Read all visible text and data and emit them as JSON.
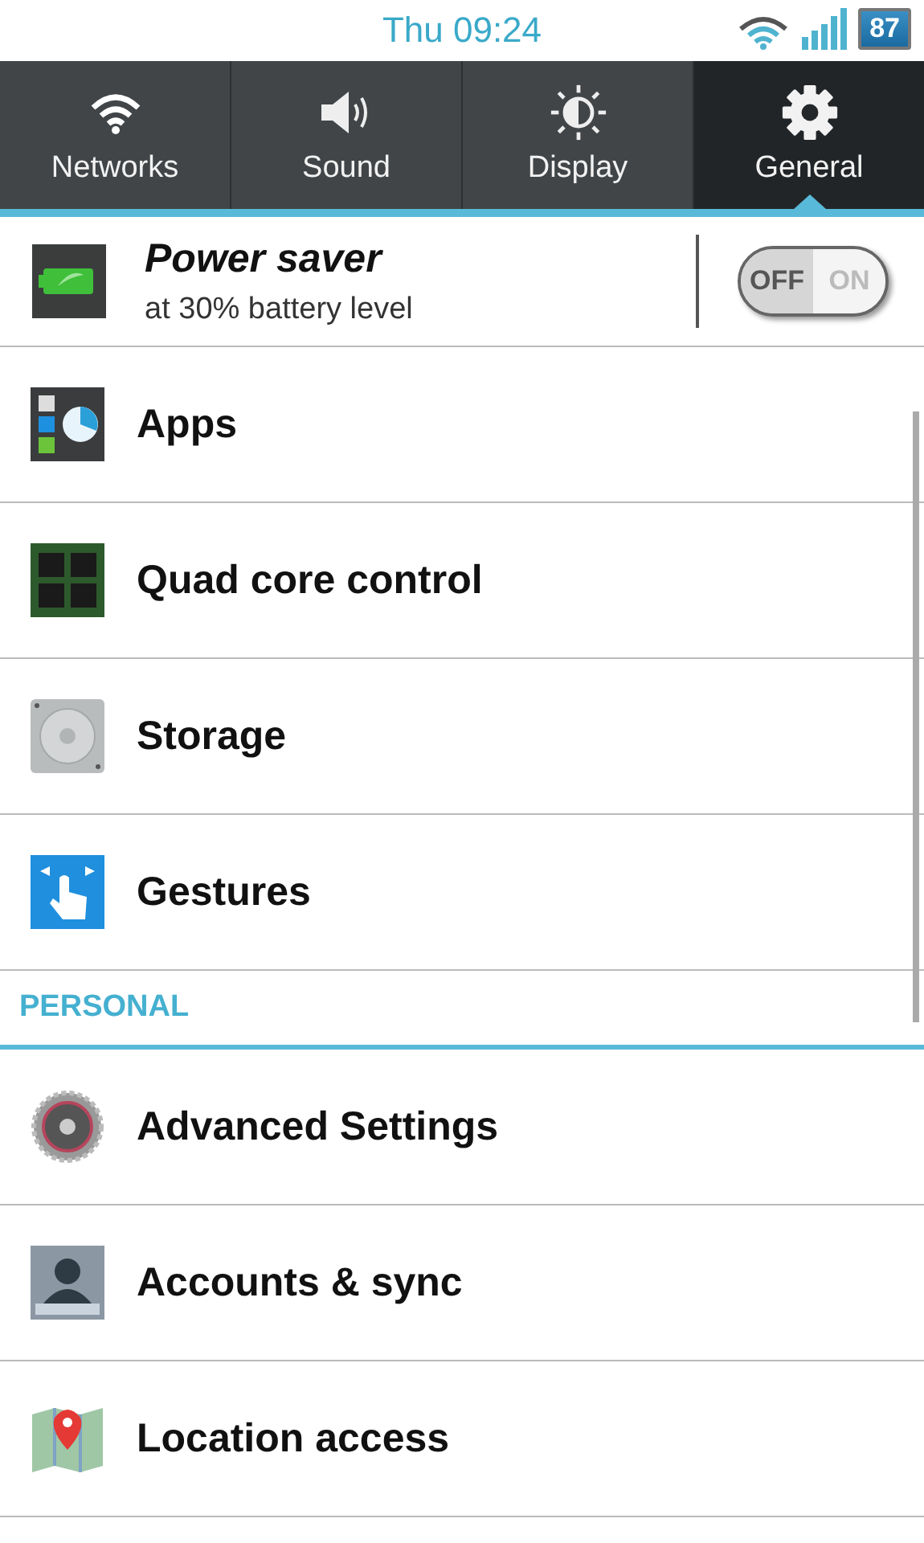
{
  "status_bar": {
    "time": "Thu 09:24",
    "battery": "87"
  },
  "tabs": [
    {
      "label": "Networks",
      "kind": "wifi",
      "selected": false
    },
    {
      "label": "Sound",
      "kind": "speaker",
      "selected": false
    },
    {
      "label": "Display",
      "kind": "brightness",
      "selected": false
    },
    {
      "label": "General",
      "kind": "gear",
      "selected": true
    }
  ],
  "power_saver": {
    "title": "Power saver",
    "subtitle": "at 30% battery level",
    "on": false,
    "off_label": "OFF",
    "on_label": "ON"
  },
  "items": [
    {
      "label": "Apps",
      "kind": "apps"
    },
    {
      "label": "Quad core control",
      "kind": "chip"
    },
    {
      "label": "Storage",
      "kind": "disk"
    },
    {
      "label": "Gestures",
      "kind": "gesture"
    }
  ],
  "section": {
    "header": "PERSONAL",
    "items": [
      {
        "label": "Advanced Settings",
        "kind": "cog"
      },
      {
        "label": "Accounts & sync",
        "kind": "account"
      },
      {
        "label": "Location access",
        "kind": "map"
      }
    ]
  }
}
